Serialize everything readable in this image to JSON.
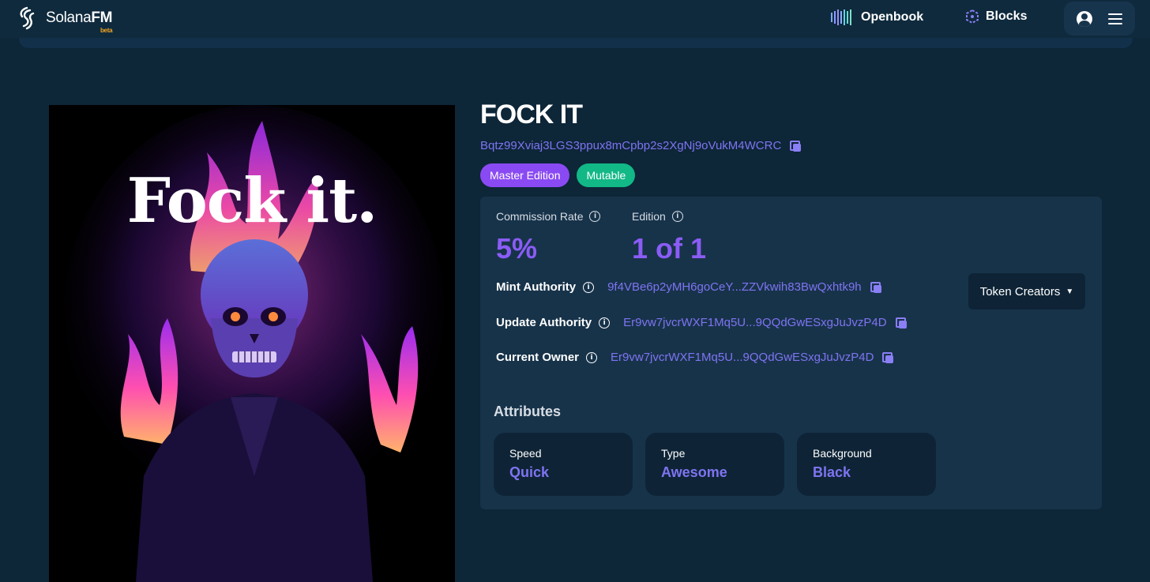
{
  "header": {
    "brand_name_regular": "Solana",
    "brand_name_bold": "FM",
    "brand_tag": "beta",
    "nav_openbook": "Openbook",
    "nav_blocks": "Blocks"
  },
  "artwork": {
    "caption": "Fock it."
  },
  "nft": {
    "title": "FOCK IT",
    "mint_address": "Bqtz99Xviaj3LGS3ppux8mCpbp2s2XgNj9oVukM4WCRC",
    "badges": [
      "Master Edition",
      "Mutable"
    ]
  },
  "details": {
    "commission_label": "Commission Rate",
    "commission_value": "5%",
    "edition_label": "Edition",
    "edition_value": "1 of 1",
    "mint_authority_label": "Mint Authority",
    "mint_authority_value": "9f4VBe6p2yMH6goCeY...ZZVkwih83BwQxhtk9h",
    "update_authority_label": "Update Authority",
    "update_authority_value": "Er9vw7jvcrWXF1Mq5U...9QQdGwESxgJuJvzP4D",
    "current_owner_label": "Current Owner",
    "current_owner_value": "Er9vw7jvcrWXF1Mq5U...9QQdGwESxgJuJvzP4D",
    "token_creators_label": "Token Creators"
  },
  "attributes": {
    "heading": "Attributes",
    "items": [
      {
        "key": "Speed",
        "value": "Quick"
      },
      {
        "key": "Type",
        "value": "Awesome"
      },
      {
        "key": "Background",
        "value": "Black"
      }
    ]
  },
  "colors": {
    "background": "#0d2638",
    "accent_purple": "#8b5cf6",
    "link_purple": "#7f74f2",
    "badge_master": "#8a4af3",
    "badge_mutable": "#12b886"
  },
  "icons": [
    "solanafm-logo-icon",
    "openbook-icon",
    "blocks-icon",
    "user-icon",
    "menu-icon",
    "copy-icon",
    "info-icon",
    "chevron-down-icon"
  ]
}
